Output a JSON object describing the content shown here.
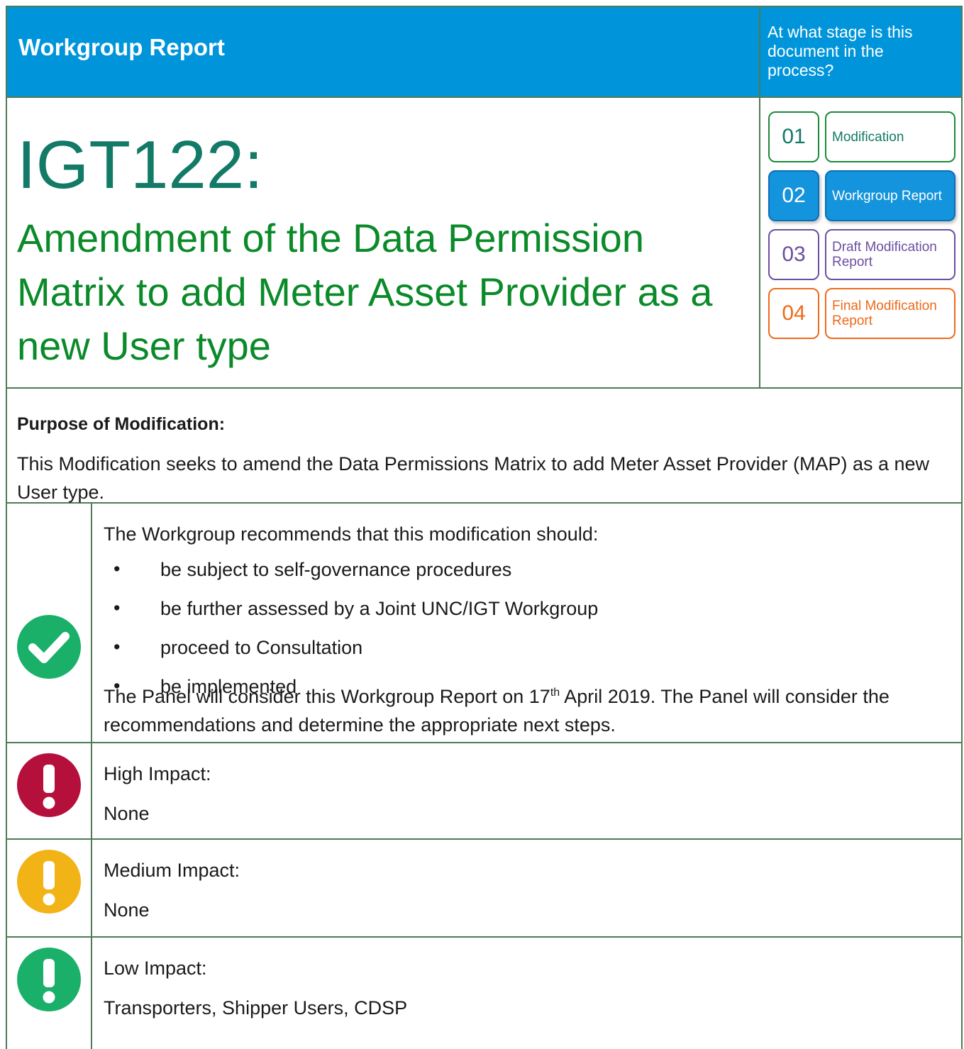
{
  "header": {
    "title": "Workgroup Report",
    "stage_question": "At what stage is this document in the process?"
  },
  "modification": {
    "code": "IGT122:",
    "title": "Amendment of the Data Permission Matrix to add Meter Asset Provider as a new User type"
  },
  "stages": [
    {
      "number": "01",
      "label": "Modification"
    },
    {
      "number": "02",
      "label": "Workgroup Report"
    },
    {
      "number": "03",
      "label": "Draft Modification Report"
    },
    {
      "number": "04",
      "label": "Final Modification Report"
    }
  ],
  "purpose": {
    "heading": "Purpose of Modification:",
    "text": "This Modification seeks to amend the Data Permissions Matrix to add Meter Asset Provider (MAP) as a new User type."
  },
  "recommendation": {
    "lead": "The Workgroup recommends that this modification should:",
    "items": [
      "be subject to self-governance procedures",
      "be further assessed by a Joint UNC/IGT Workgroup",
      "proceed to Consultation",
      "be implemented"
    ],
    "panel_pre": "The Panel will consider this Workgroup Report on 17",
    "panel_sup": "th",
    "panel_post": " April 2019.  The Panel will consider the recommendations and determine the appropriate next steps."
  },
  "impacts": {
    "high": {
      "label": "High Impact:",
      "value": "None"
    },
    "medium": {
      "label": "Medium Impact:",
      "value": "None"
    },
    "low": {
      "label": "Low Impact:",
      "value": "Transporters, Shipper Users, CDSP"
    }
  },
  "colors": {
    "header_bg": "#0095da",
    "border": "#4f7a56",
    "check": "#1ab06a",
    "high": "#b5103c",
    "medium": "#f2b316",
    "low": "#1ab06a"
  }
}
